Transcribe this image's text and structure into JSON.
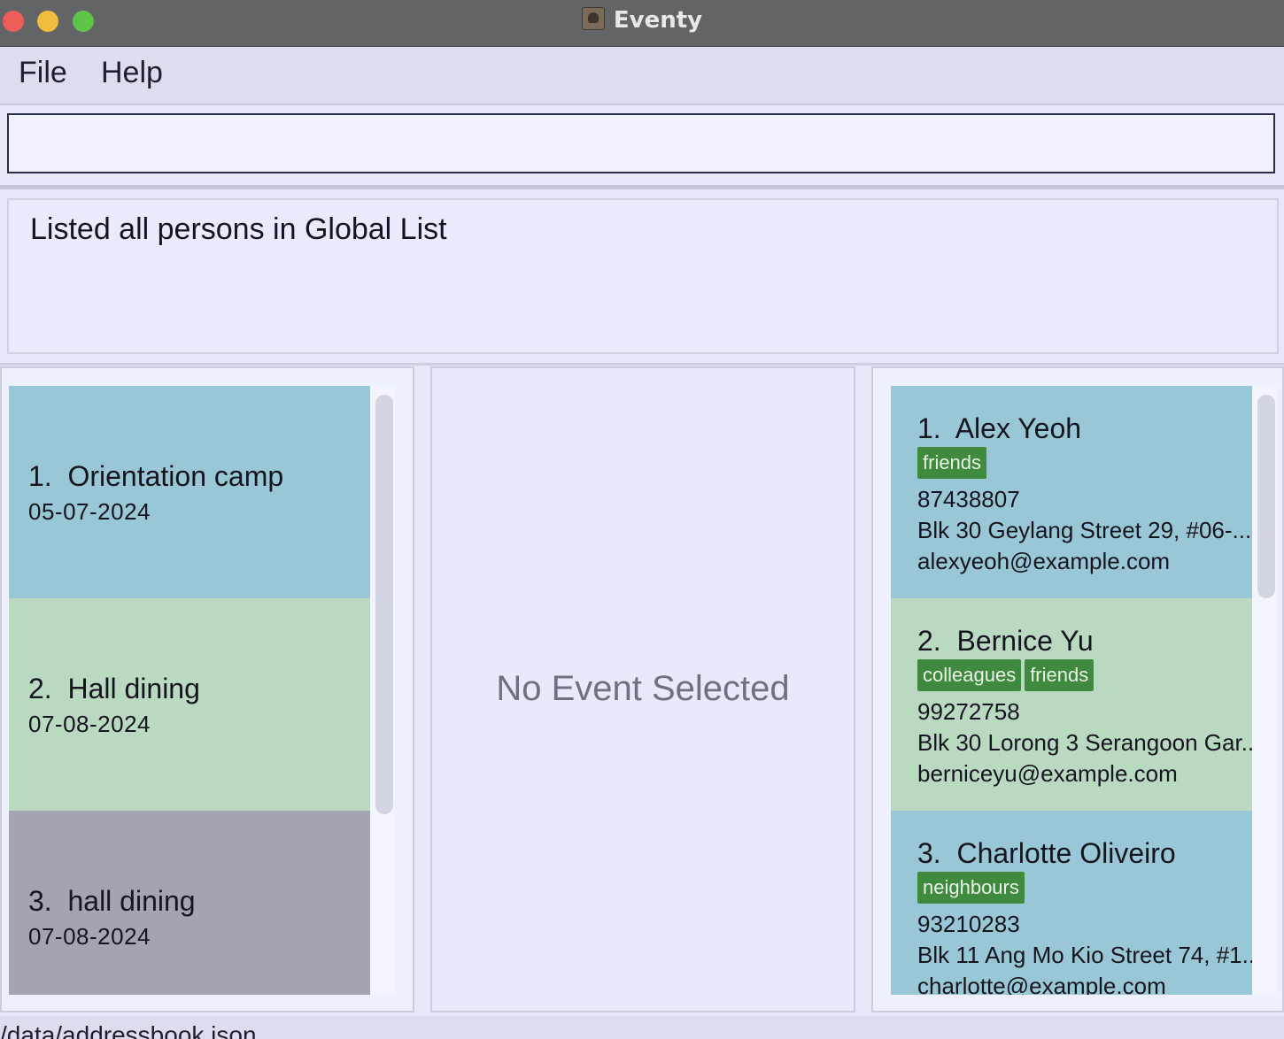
{
  "window": {
    "title": "Eventy"
  },
  "menu": {
    "file": "File",
    "help": "Help"
  },
  "command": {
    "value": "",
    "placeholder": ""
  },
  "result": {
    "message": "Listed all persons in Global List"
  },
  "events": [
    {
      "index": "1.",
      "name": "Orientation camp",
      "date": "05-07-2024",
      "color": "#99c7d6"
    },
    {
      "index": "2.",
      "name": "Hall dining",
      "date": "07-08-2024",
      "color": "#b9d9c1"
    },
    {
      "index": "3.",
      "name": "hall dining",
      "date": "07-08-2024",
      "color": "#a3a3b1"
    }
  ],
  "event_detail": {
    "placeholder": "No Event Selected"
  },
  "persons": [
    {
      "index": "1.",
      "name": "Alex Yeoh",
      "tags": [
        "friends"
      ],
      "phone": "87438807",
      "address": "Blk 30 Geylang Street 29, #06-...",
      "email": "alexyeoh@example.com"
    },
    {
      "index": "2.",
      "name": "Bernice Yu",
      "tags": [
        "colleagues",
        "friends"
      ],
      "phone": "99272758",
      "address": "Blk 30 Lorong 3 Serangoon Gar...",
      "email": "berniceyu@example.com"
    },
    {
      "index": "3.",
      "name": "Charlotte Oliveiro",
      "tags": [
        "neighbours"
      ],
      "phone": "93210283",
      "address": "Blk 11 Ang Mo Kio Street 74, #1...",
      "email": "charlotte@example.com"
    }
  ],
  "status": {
    "file_path": "/data/addressbook.json"
  },
  "colors": {
    "tag": "#3f8a3e",
    "card_blue": "#99c7d6",
    "card_green": "#b9d9c1",
    "card_grey": "#a3a3b1"
  }
}
